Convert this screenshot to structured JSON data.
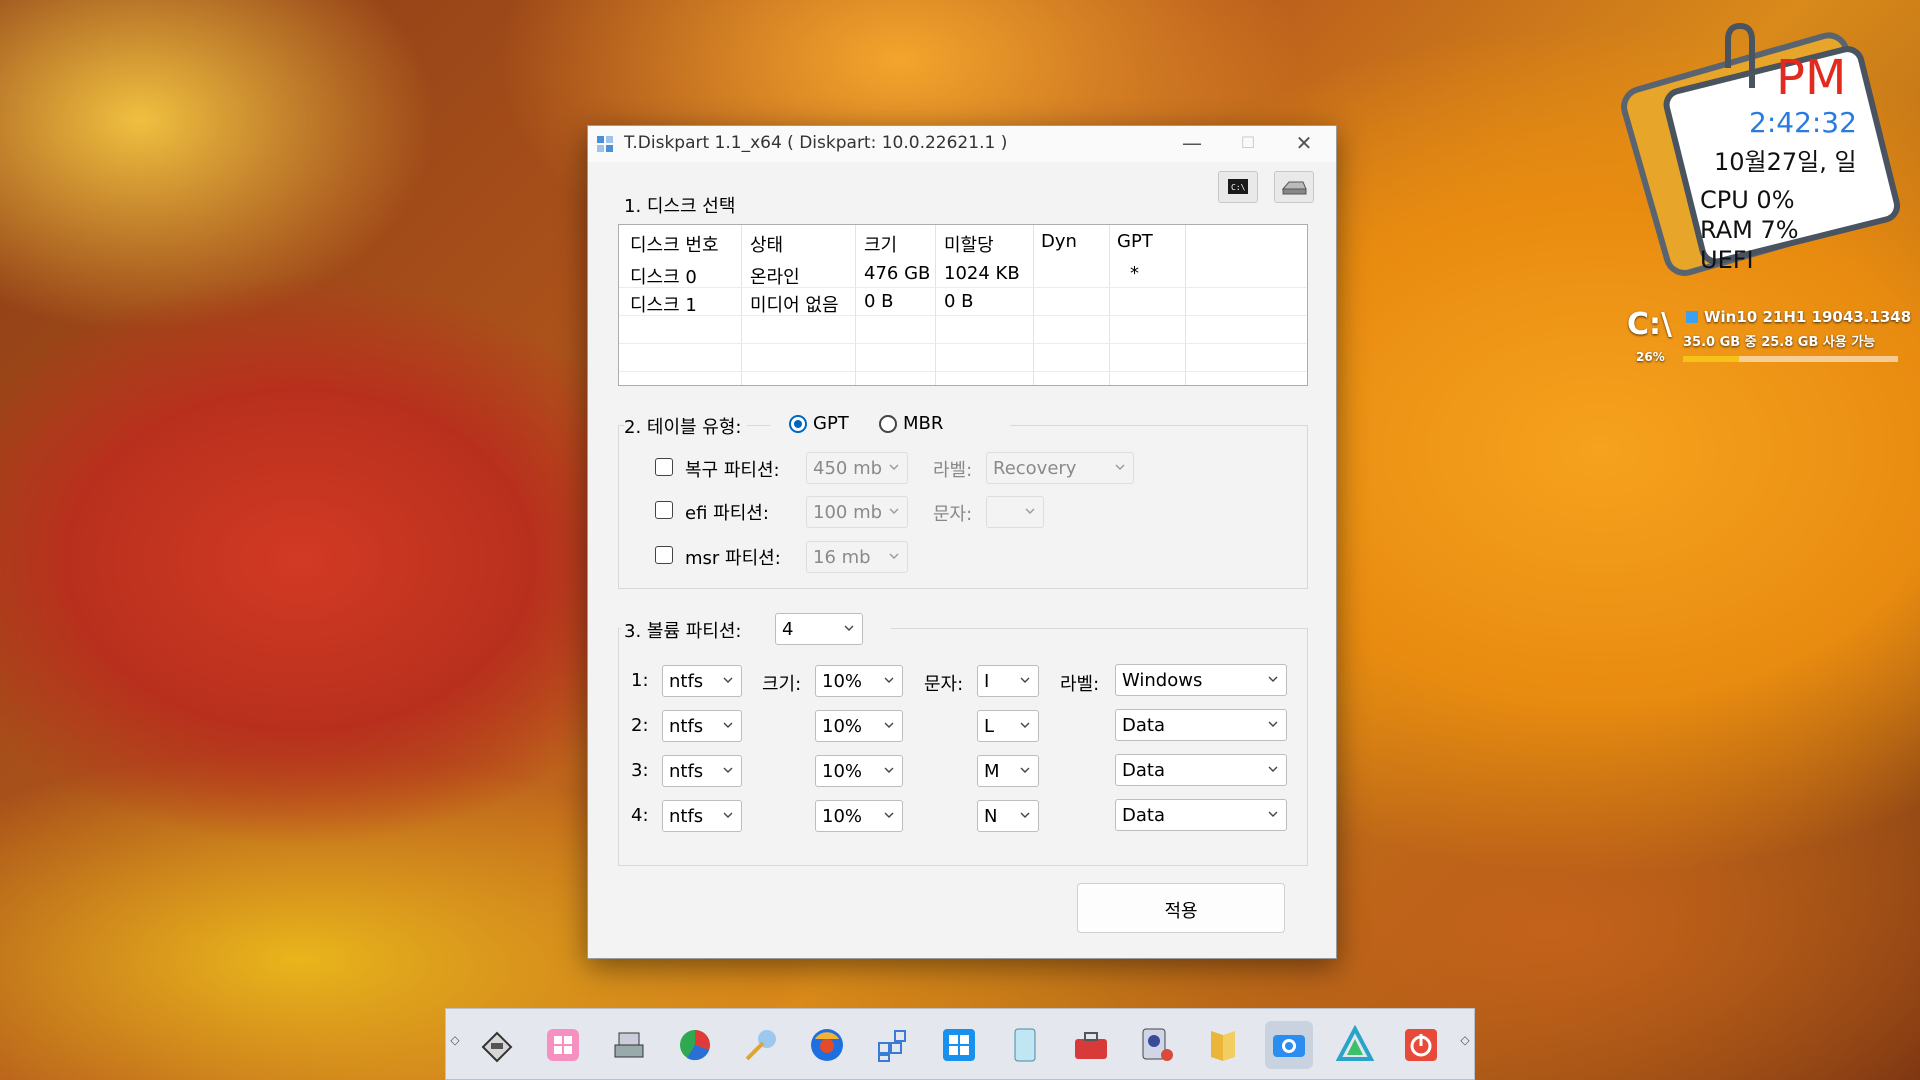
{
  "window": {
    "title": "T.Diskpart 1.1_x64 ( Diskpart: 10.0.22621.1 )",
    "minimize_glyph": "—",
    "maximize_glyph": "☐",
    "close_glyph": "✕"
  },
  "section1": {
    "label": "1. 디스크 선택",
    "columns": [
      "디스크 번호",
      "상태",
      "크기",
      "미할당",
      "Dyn",
      "GPT"
    ],
    "rows": [
      [
        "디스크 0",
        "온라인",
        "476 GB",
        "1024 KB",
        "",
        "*"
      ],
      [
        "디스크 1",
        "미디어 없음",
        "0 B",
        "0 B",
        "",
        ""
      ]
    ]
  },
  "section2": {
    "label": "2. 테이블 유형:",
    "gpt_label": "GPT",
    "mbr_label": "MBR",
    "selected": "GPT",
    "recovery": {
      "label": "복구 파티션:",
      "size": "450 mb",
      "field_label": "라벨:",
      "field_value": "Recovery"
    },
    "efi": {
      "label": "efi 파티션:",
      "size": "100 mb",
      "field_label": "문자:",
      "field_value": ""
    },
    "msr": {
      "label": "msr 파티션:",
      "size": "16 mb"
    }
  },
  "section3": {
    "label": "3. 볼륨 파티션:",
    "count": "4",
    "size_label": "크기:",
    "letter_label": "문자:",
    "volume_label": "라벨:",
    "rows": [
      {
        "num": "1:",
        "fs": "ntfs",
        "size": "10%",
        "letter": "I",
        "label": "Windows"
      },
      {
        "num": "2:",
        "fs": "ntfs",
        "size": "10%",
        "letter": "L",
        "label": "Data"
      },
      {
        "num": "3:",
        "fs": "ntfs",
        "size": "10%",
        "letter": "M",
        "label": "Data"
      },
      {
        "num": "4:",
        "fs": "ntfs",
        "size": "10%",
        "letter": "N",
        "label": "Data"
      }
    ]
  },
  "apply_label": "적용",
  "widget": {
    "ampm": "PM",
    "time": "2:42:32",
    "date": "10월27일, 일",
    "cpu": "CPU  0%",
    "ram": "RAM  7%",
    "boot": "UEFI",
    "drive": "C:\\",
    "drive_percent": "26%",
    "os": "Win10 21H1 19043.1348",
    "space": "35.0 GB 중  25.8 GB 사용 가능",
    "drive_fill": 0.26
  },
  "taskbar_icons": [
    "disk-tool-icon",
    "pink-grid-icon",
    "drive-manager-icon",
    "partition-pie-icon",
    "wizard-icon",
    "browser-icon",
    "apps-grid-icon",
    "windows-icon",
    "notepad-icon",
    "toolbox-icon",
    "disk-settings-icon",
    "folder-icon",
    "camera-icon",
    "triangle-icon",
    "power-icon"
  ]
}
